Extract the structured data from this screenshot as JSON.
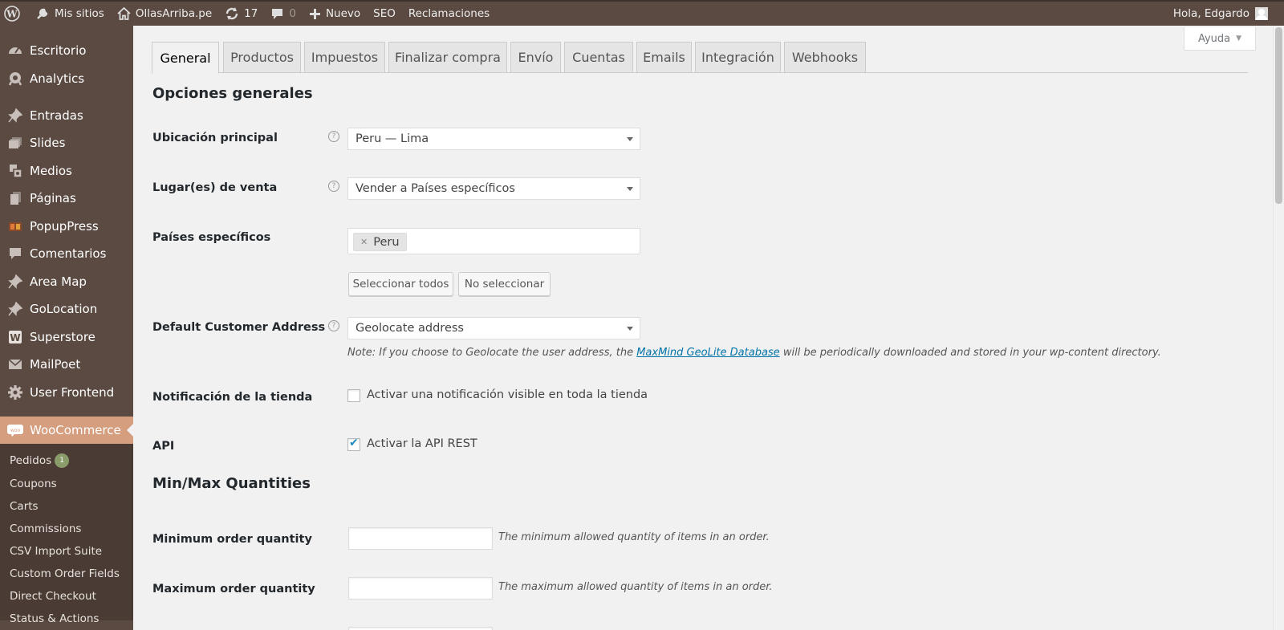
{
  "adminbar": {
    "mis_sitios": "Mis sitios",
    "site_name": "OllasArriba.pe",
    "updates_count": "17",
    "comments_count": "0",
    "nuevo": "Nuevo",
    "seo": "SEO",
    "reclamaciones": "Reclamaciones",
    "greeting": "Hola, Edgardo"
  },
  "sidebar": {
    "items": [
      {
        "label": "Escritorio"
      },
      {
        "label": "Analytics"
      },
      {
        "label": "Entradas"
      },
      {
        "label": "Slides"
      },
      {
        "label": "Medios"
      },
      {
        "label": "Páginas"
      },
      {
        "label": "PopupPress"
      },
      {
        "label": "Comentarios"
      },
      {
        "label": "Area Map"
      },
      {
        "label": "GoLocation"
      },
      {
        "label": "Superstore"
      },
      {
        "label": "MailPoet"
      },
      {
        "label": "User Frontend"
      },
      {
        "label": "WooCommerce"
      }
    ],
    "submenu": [
      {
        "label": "Pedidos",
        "badge": "1"
      },
      {
        "label": "Coupons"
      },
      {
        "label": "Carts"
      },
      {
        "label": "Commissions"
      },
      {
        "label": "CSV Import Suite"
      },
      {
        "label": "Custom Order Fields"
      },
      {
        "label": "Direct Checkout"
      },
      {
        "label": "Status & Actions"
      }
    ]
  },
  "help": {
    "label": "Ayuda"
  },
  "tabs": [
    {
      "label": "General",
      "active": true
    },
    {
      "label": "Productos"
    },
    {
      "label": "Impuestos"
    },
    {
      "label": "Finalizar compra"
    },
    {
      "label": "Envío"
    },
    {
      "label": "Cuentas"
    },
    {
      "label": "Emails"
    },
    {
      "label": "Integración"
    },
    {
      "label": "Webhooks"
    }
  ],
  "general": {
    "title": "Opciones generales",
    "ubicacion": {
      "label": "Ubicación principal",
      "value": "Peru — Lima"
    },
    "lugar_venta": {
      "label": "Lugar(es) de venta",
      "value": "Vender a Países específicos"
    },
    "paises": {
      "label": "Países específicos",
      "chips": [
        "Peru"
      ],
      "select_all": "Seleccionar todos",
      "select_none": "No seleccionar"
    },
    "default_address": {
      "label": "Default Customer Address",
      "value": "Geolocate address",
      "note_before": "Note: If you choose to Geolocate the user address, the ",
      "note_link": "MaxMind GeoLite Database",
      "note_after": " will be periodically downloaded and stored in your wp-content directory."
    },
    "notificacion": {
      "label": "Notificación de la tienda",
      "checkbox_label": "Activar una notificación visible en toda la tienda",
      "checked": false
    },
    "api": {
      "label": "API",
      "checkbox_label": "Activar la API REST",
      "checked": true
    }
  },
  "minmax": {
    "title": "Min/Max Quantities",
    "min": {
      "label": "Minimum order quantity",
      "value": "",
      "desc": "The minimum allowed quantity of items in an order."
    },
    "max": {
      "label": "Maximum order quantity",
      "value": "",
      "desc": "The maximum allowed quantity of items in an order."
    }
  }
}
